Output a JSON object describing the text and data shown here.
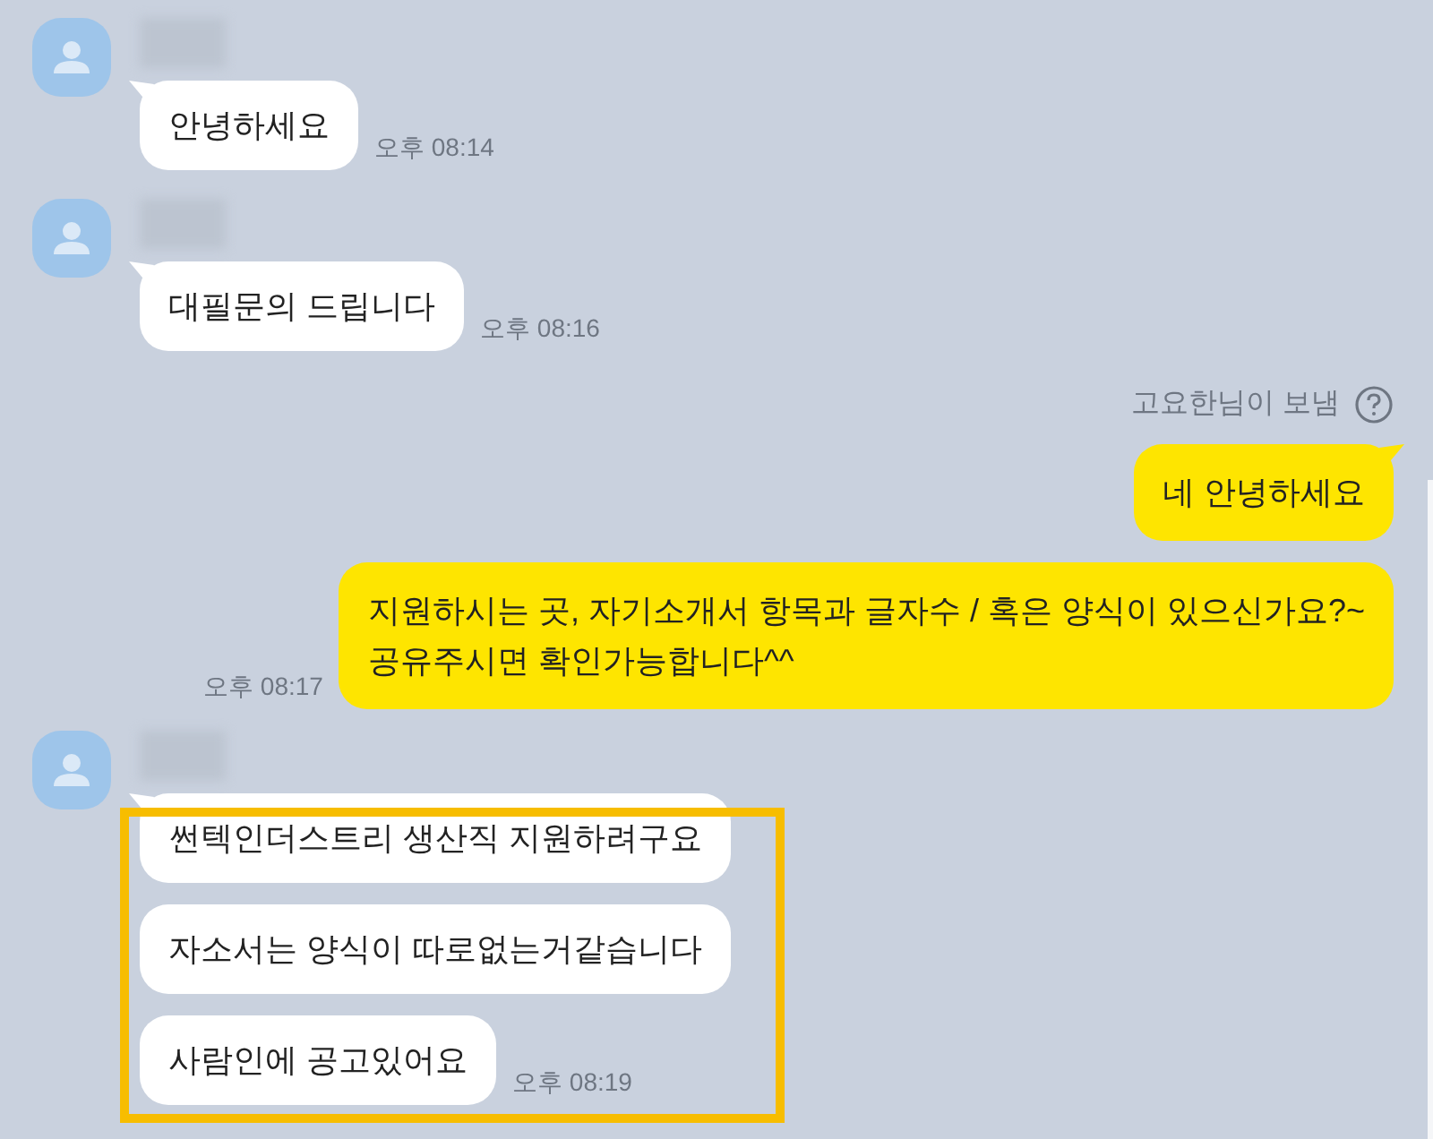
{
  "groups": [
    {
      "kind": "received",
      "highlighted": false,
      "messages": [
        {
          "text": "안녕하세요",
          "time": "오후 08:14"
        }
      ]
    },
    {
      "kind": "received",
      "highlighted": false,
      "messages": [
        {
          "text": "대필문의 드립니다",
          "time": "오후 08:16"
        }
      ]
    },
    {
      "kind": "sent",
      "note": "고요한님이 보냄",
      "highlighted": false,
      "messages": [
        {
          "text": "네 안녕하세요"
        },
        {
          "text": "지원하시는 곳, 자기소개서 항목과 글자수 / 혹은 양식이 있으신가요?~\n공유주시면 확인가능합니다^^",
          "time": "오후 08:17"
        }
      ]
    },
    {
      "kind": "received",
      "highlighted": true,
      "messages": [
        {
          "text": "썬텍인더스트리 생산직 지원하려구요"
        },
        {
          "text": "자소서는 양식이 따로없는거같습니다"
        },
        {
          "text": "사람인에 공고있어요",
          "time": "오후 08:19"
        }
      ]
    }
  ]
}
